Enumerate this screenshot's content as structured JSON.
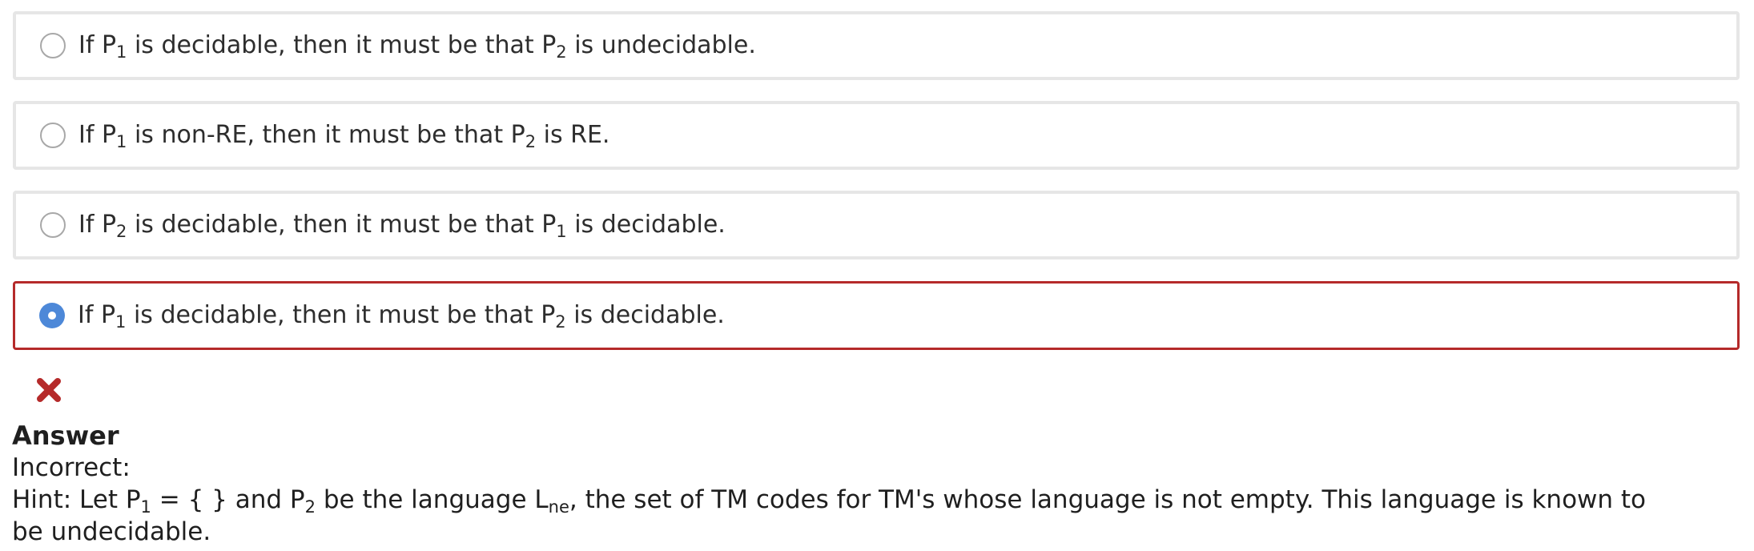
{
  "options": [
    {
      "a": "If P",
      "s1": "1",
      "b": " is decidable, then it must be that P",
      "s2": "2",
      "c": " is undecidable."
    },
    {
      "a": "If P",
      "s1": "1",
      "b": " is non-RE, then it must be that P",
      "s2": "2",
      "c": " is RE."
    },
    {
      "a": "If P",
      "s1": "2",
      "b": " is decidable, then it must be that P",
      "s2": "1",
      "c": " is decidable."
    },
    {
      "a": "If P",
      "s1": "1",
      "b": " is decidable, then it must be that P",
      "s2": "2",
      "c": " is decidable."
    }
  ],
  "selected_index": 3,
  "result_icon": "x-mark-icon",
  "colors": {
    "radio_checked": "#4d88d8",
    "selected_border": "#b52a2a",
    "incorrect_icon": "#b52a2a"
  },
  "answer": {
    "heading": "Answer",
    "status": "Incorrect:",
    "hint": {
      "p1": "Hint: Let P",
      "s1": "1",
      "p2": " = { } and P",
      "s2": "2",
      "p3": " be the language L",
      "s3": "ne",
      "p4": ", the set of TM codes for TM's whose language is not empty. This language is known to be undecidable."
    }
  }
}
